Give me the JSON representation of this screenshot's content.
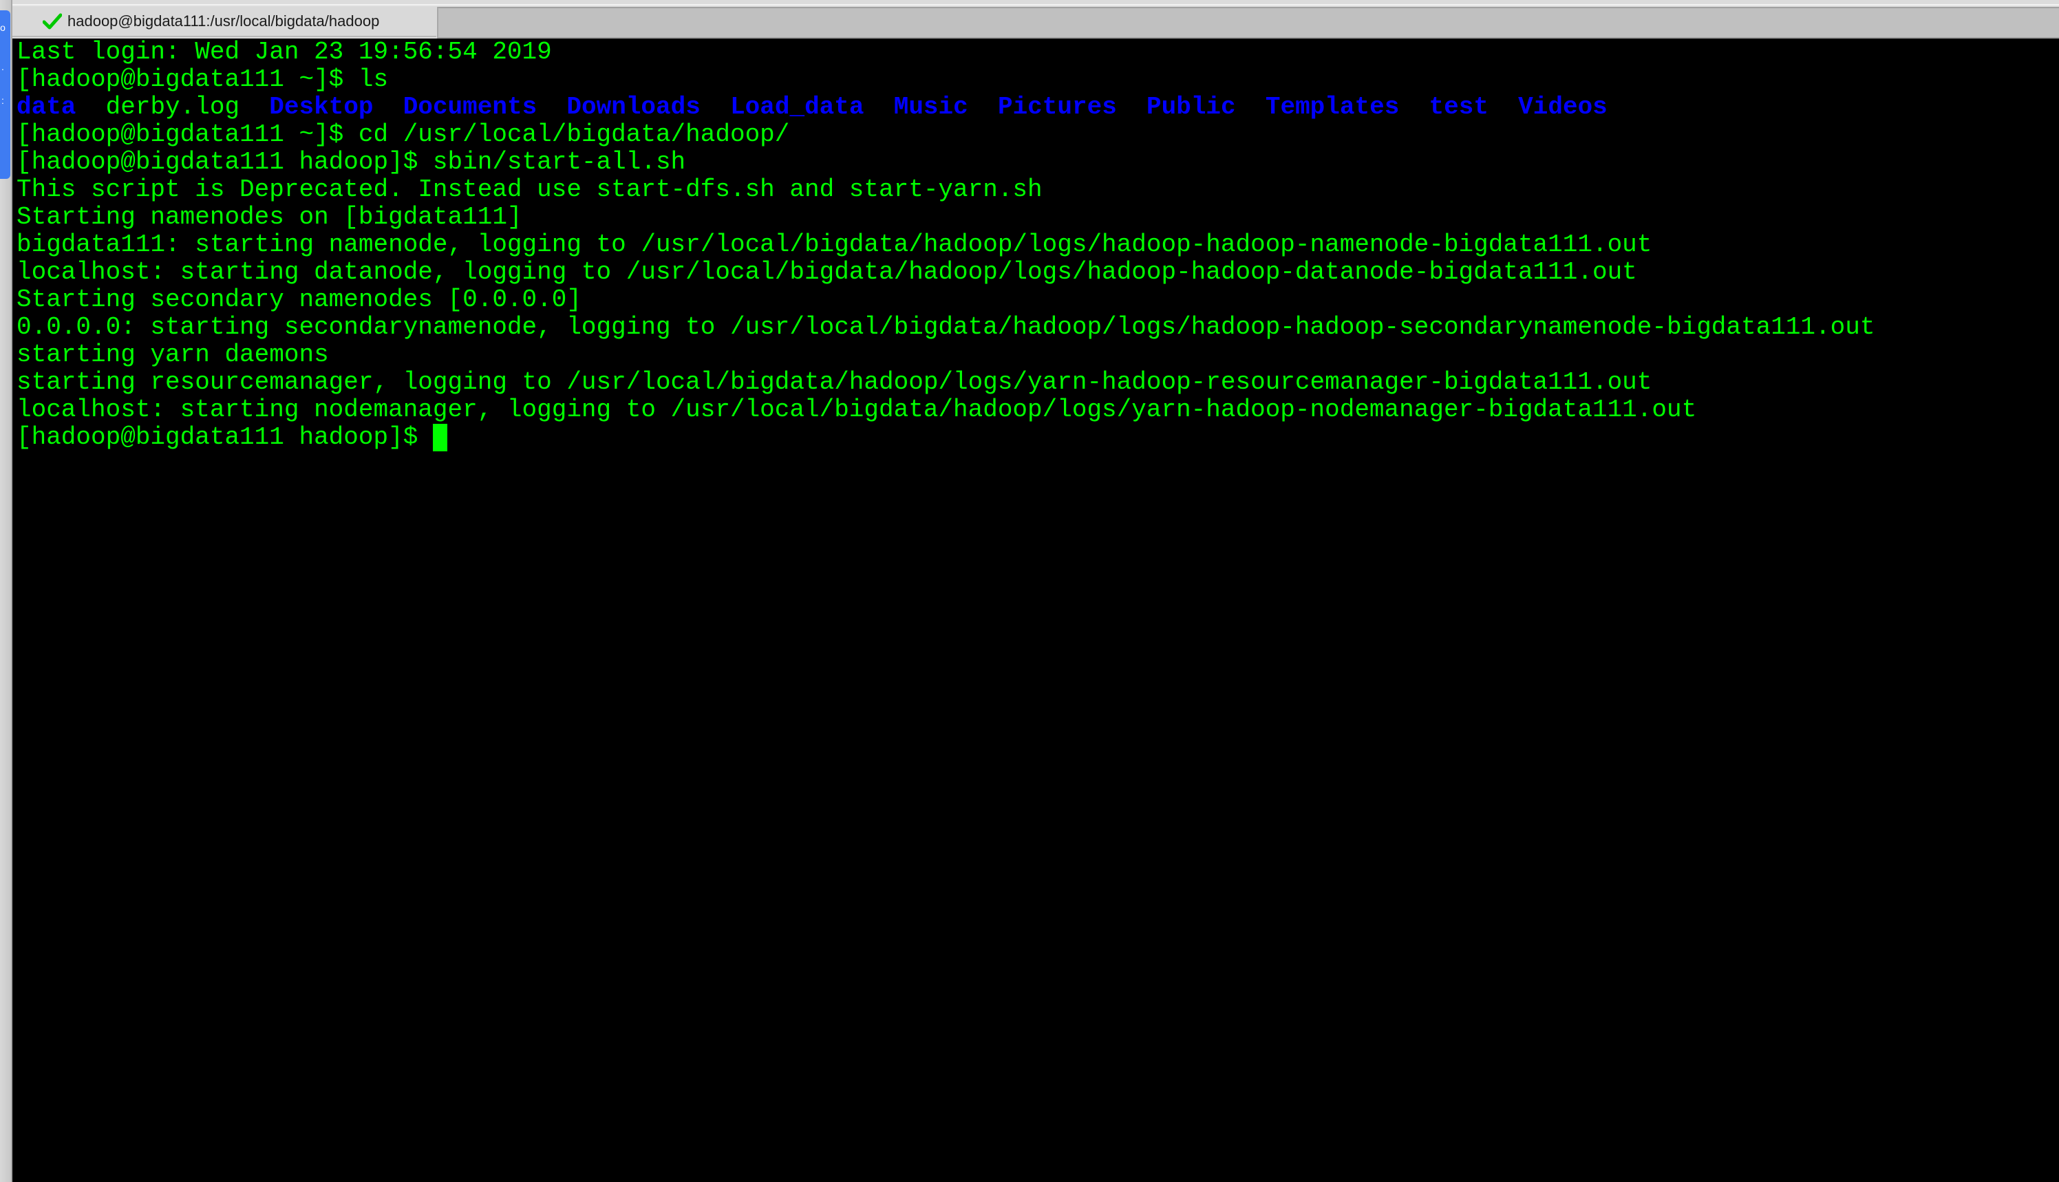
{
  "window": {
    "tab": {
      "title": "hadoop@bigdata111:/usr/local/bigdata/hadoop",
      "status_icon": "checkmark-icon",
      "status_color": "#00c800"
    }
  },
  "colors": {
    "terminal_bg": "#000000",
    "text": "#00ff00",
    "directory": "#0000ff",
    "cursor": "#00ff00"
  },
  "terminal": {
    "lines": [
      [
        {
          "text": "Last login: Wed Jan 23 19:56:54 2019",
          "kind": "text"
        }
      ],
      [
        {
          "text": "[hadoop@bigdata111 ~]$ ls",
          "kind": "text"
        }
      ],
      [
        {
          "text": "data",
          "kind": "dir"
        },
        {
          "text": "  ",
          "kind": "text"
        },
        {
          "text": "derby.log",
          "kind": "file"
        },
        {
          "text": "  ",
          "kind": "text"
        },
        {
          "text": "Desktop",
          "kind": "dir"
        },
        {
          "text": "  ",
          "kind": "text"
        },
        {
          "text": "Documents",
          "kind": "dir"
        },
        {
          "text": "  ",
          "kind": "text"
        },
        {
          "text": "Downloads",
          "kind": "dir"
        },
        {
          "text": "  ",
          "kind": "text"
        },
        {
          "text": "Load_data",
          "kind": "dir"
        },
        {
          "text": "  ",
          "kind": "text"
        },
        {
          "text": "Music",
          "kind": "dir"
        },
        {
          "text": "  ",
          "kind": "text"
        },
        {
          "text": "Pictures",
          "kind": "dir"
        },
        {
          "text": "  ",
          "kind": "text"
        },
        {
          "text": "Public",
          "kind": "dir"
        },
        {
          "text": "  ",
          "kind": "text"
        },
        {
          "text": "Templates",
          "kind": "dir"
        },
        {
          "text": "  ",
          "kind": "text"
        },
        {
          "text": "test",
          "kind": "dir"
        },
        {
          "text": "  ",
          "kind": "text"
        },
        {
          "text": "Videos",
          "kind": "dir"
        }
      ],
      [
        {
          "text": "[hadoop@bigdata111 ~]$ cd /usr/local/bigdata/hadoop/",
          "kind": "text"
        }
      ],
      [
        {
          "text": "[hadoop@bigdata111 hadoop]$ sbin/start-all.sh",
          "kind": "text"
        }
      ],
      [
        {
          "text": "This script is Deprecated. Instead use start-dfs.sh and start-yarn.sh",
          "kind": "text"
        }
      ],
      [
        {
          "text": "Starting namenodes on [bigdata111]",
          "kind": "text"
        }
      ],
      [
        {
          "text": "bigdata111: starting namenode, logging to /usr/local/bigdata/hadoop/logs/hadoop-hadoop-namenode-bigdata111.out",
          "kind": "text"
        }
      ],
      [
        {
          "text": "localhost: starting datanode, logging to /usr/local/bigdata/hadoop/logs/hadoop-hadoop-datanode-bigdata111.out",
          "kind": "text"
        }
      ],
      [
        {
          "text": "Starting secondary namenodes [0.0.0.0]",
          "kind": "text"
        }
      ],
      [
        {
          "text": "0.0.0.0: starting secondarynamenode, logging to /usr/local/bigdata/hadoop/logs/hadoop-hadoop-secondarynamenode-bigdata111.out",
          "kind": "text"
        }
      ],
      [
        {
          "text": "starting yarn daemons",
          "kind": "text"
        }
      ],
      [
        {
          "text": "starting resourcemanager, logging to /usr/local/bigdata/hadoop/logs/yarn-hadoop-resourcemanager-bigdata111.out",
          "kind": "text"
        }
      ],
      [
        {
          "text": "localhost: starting nodemanager, logging to /usr/local/bigdata/hadoop/logs/yarn-hadoop-nodemanager-bigdata111.out",
          "kind": "text"
        }
      ]
    ],
    "prompt": "[hadoop@bigdata111 hadoop]$ "
  }
}
